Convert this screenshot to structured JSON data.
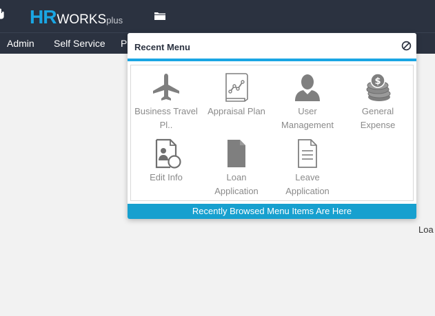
{
  "app": {
    "logo_hr": "HR",
    "logo_works": "WORKS",
    "logo_plus": "plus"
  },
  "nav": {
    "items": [
      {
        "label": "Admin"
      },
      {
        "label": "Self Service"
      },
      {
        "label": "Pe"
      }
    ]
  },
  "page": {
    "loading_text": "Loa"
  },
  "recent_menu": {
    "title": "Recent Menu",
    "footer": "Recently Browsed Menu Items Are Here",
    "items": [
      {
        "line1": "Business Travel",
        "line2": "Pl..",
        "icon": "airplane-icon"
      },
      {
        "line1": "Appraisal Plan",
        "line2": "",
        "icon": "chart-document-icon"
      },
      {
        "line1": "User",
        "line2": "Management",
        "icon": "user-icon"
      },
      {
        "line1": "General",
        "line2": "Expense",
        "icon": "coins-icon"
      },
      {
        "line1": "Edit Info",
        "line2": "",
        "icon": "profile-edit-icon"
      },
      {
        "line1": "Loan",
        "line2": "Application",
        "icon": "document-filled-icon"
      },
      {
        "line1": "Leave",
        "line2": "Application",
        "icon": "document-outline-icon"
      }
    ]
  },
  "colors": {
    "topbar": "#2b3240",
    "accent": "#1aa6e3",
    "footer": "#17a0cf",
    "icon_gray": "#7f7f7f"
  }
}
